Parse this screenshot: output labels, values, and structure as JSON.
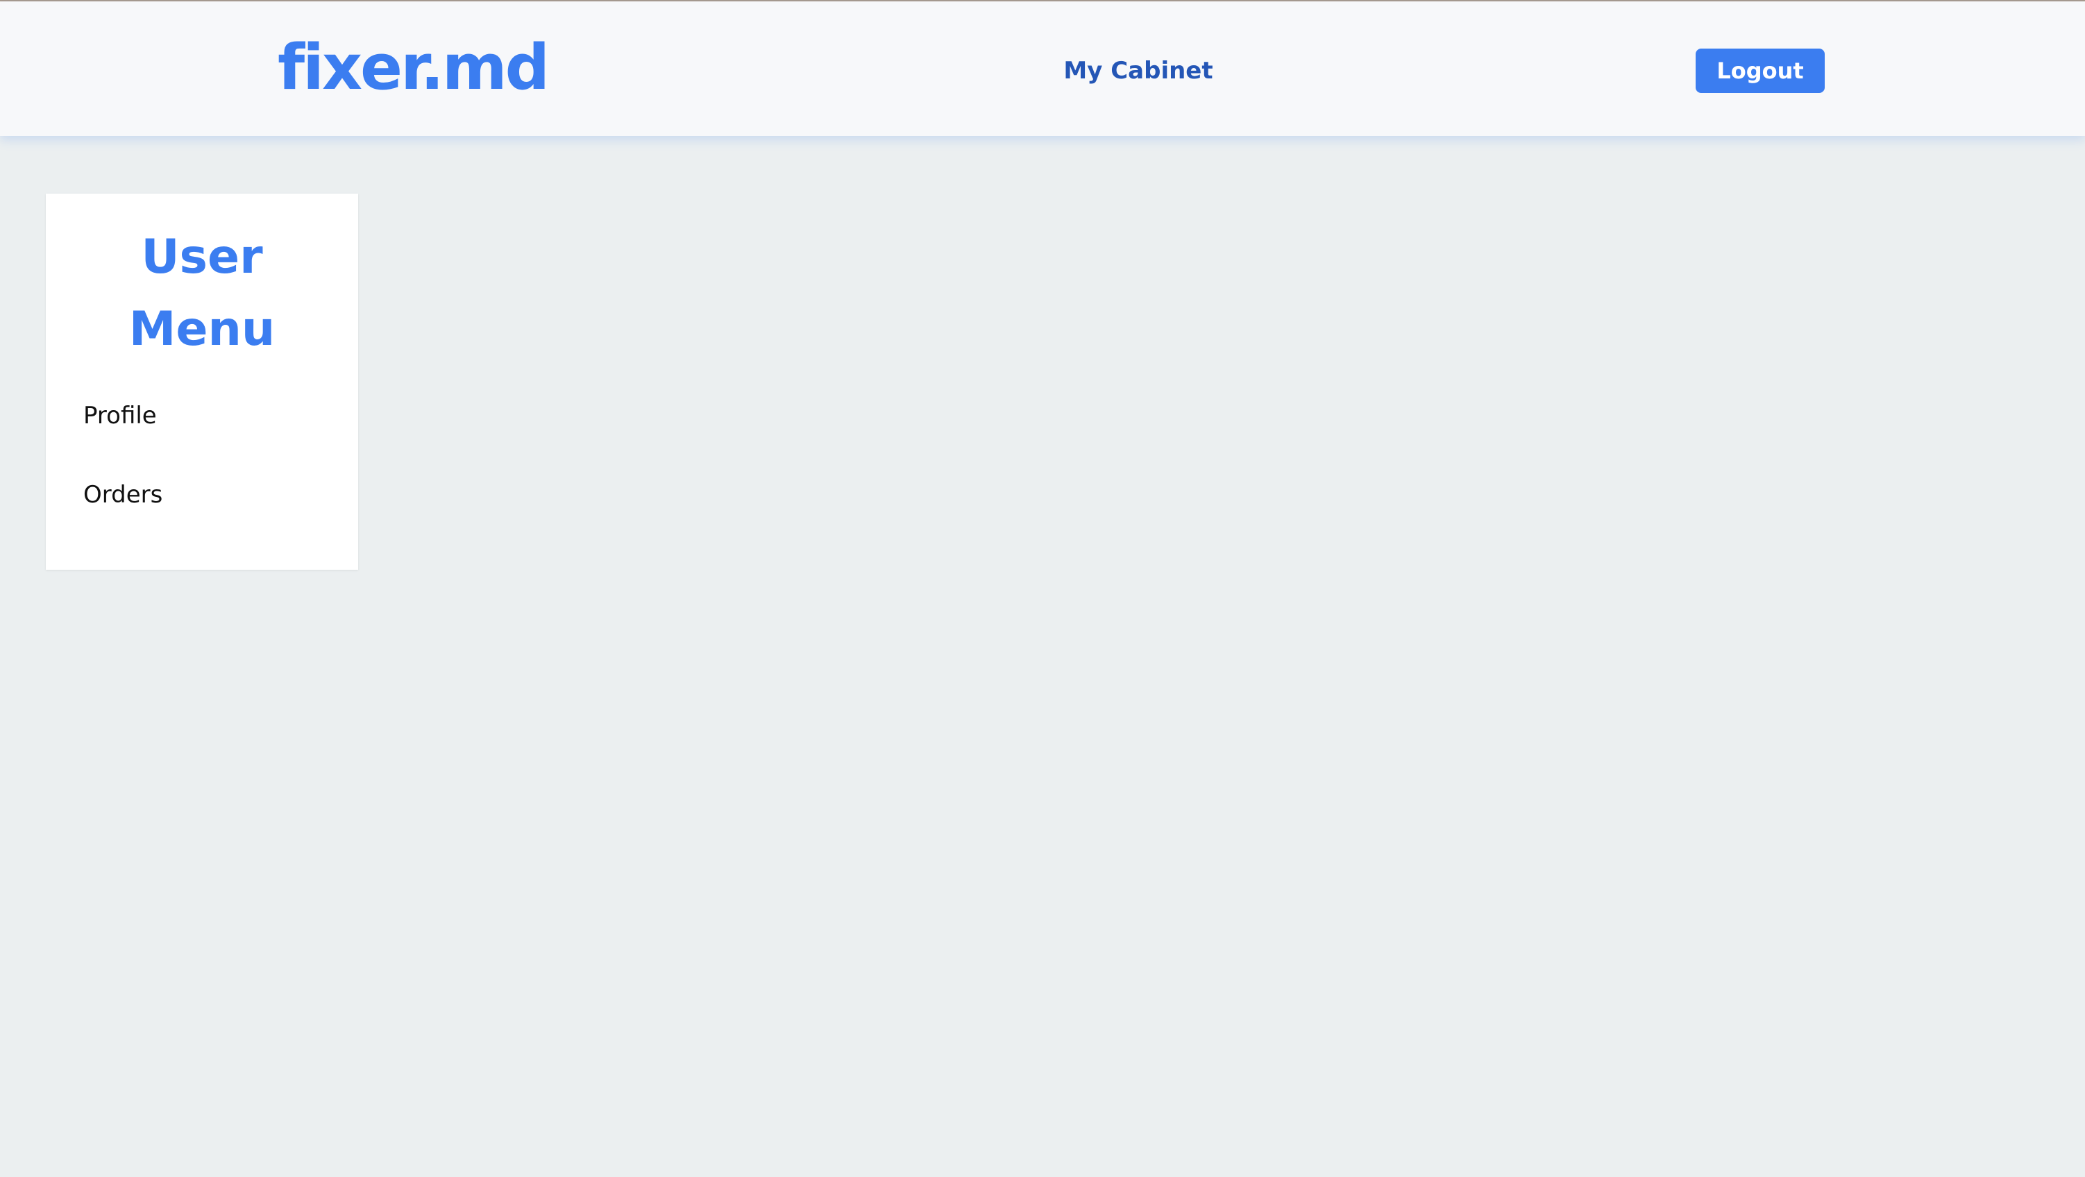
{
  "header": {
    "logo_text": "fixer.md",
    "nav_link_label": "My Cabinet",
    "logout_label": "Logout"
  },
  "sidebar": {
    "title_line1": "User",
    "title_line2": "Menu",
    "items": [
      {
        "label": "Profile"
      },
      {
        "label": "Orders"
      }
    ]
  },
  "colors": {
    "brand_blue": "#3b7df0",
    "nav_dark_blue": "#2456b6",
    "page_background": "#ebeff0",
    "header_background": "#f7f8fa"
  }
}
